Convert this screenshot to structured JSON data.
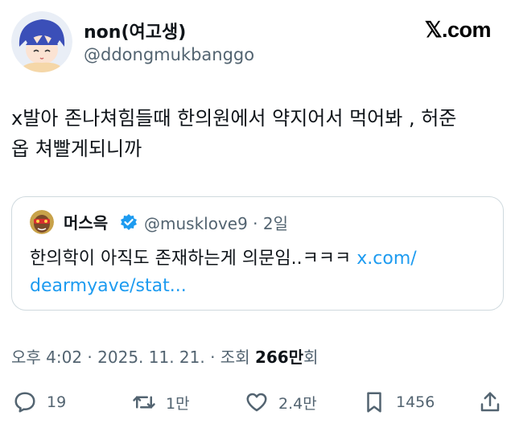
{
  "author": {
    "display_name": "non(여고생)",
    "handle": "@ddongmukbanggo",
    "avatar_icon": "anime-girl-avatar-icon"
  },
  "brand": {
    "logo_text": "𝕏.com"
  },
  "tweet": {
    "text_line1": "x발아 존나쳐힘들때 한의원에서 약지어서 먹어봐 , 허준",
    "text_line2": "옵 쳐빨게되니까"
  },
  "quote": {
    "display_name": "머스윽",
    "handle_time": "@musklove9 · 2일",
    "text_part1": "한의학이 아직도 존재하는게 의문임..ㅋㅋㅋ ",
    "link_part1": "x.com/",
    "link_part2": "dearmyave/stat...",
    "verified_icon": "verified-badge-icon"
  },
  "meta": {
    "prefix": "오후 4:02 · 2025. 11. 21. · 조회 ",
    "views": "266만",
    "suffix": "회"
  },
  "actions": {
    "replies": "19",
    "retweets": "1만",
    "likes": "2.4만",
    "bookmarks": "1456"
  },
  "colors": {
    "accent": "#1d9bf0",
    "text": "#0f1419",
    "muted": "#536471",
    "border": "#cfd9de"
  }
}
